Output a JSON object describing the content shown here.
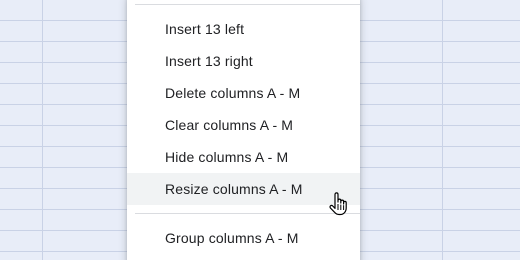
{
  "menu": {
    "items": [
      {
        "label": "Insert 13 left"
      },
      {
        "label": "Insert 13 right"
      },
      {
        "label": "Delete columns A - M"
      },
      {
        "label": "Clear columns A - M"
      },
      {
        "label": "Hide columns A - M"
      },
      {
        "label": "Resize columns A - M",
        "hovered": true
      },
      {
        "label": "Group columns A - M"
      }
    ]
  },
  "cursor": {
    "icon": "hand-pointer-icon"
  },
  "colors": {
    "sheet_background": "#e8edf8",
    "menu_background": "#ffffff",
    "hover_background": "#f1f3f4",
    "text": "#202124"
  }
}
